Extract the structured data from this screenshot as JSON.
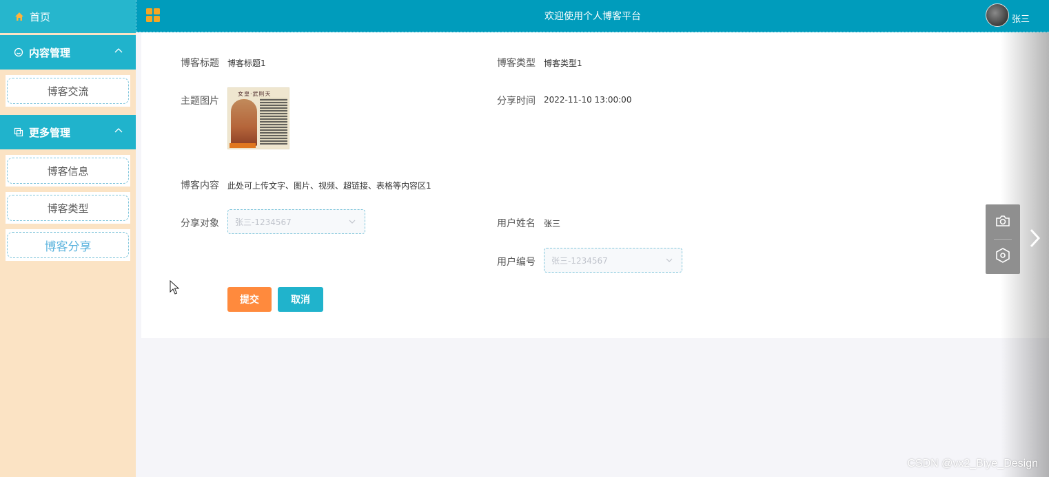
{
  "sidebar": {
    "home": "首页",
    "groups": [
      {
        "title": "内容管理",
        "items": [
          "博客交流"
        ]
      },
      {
        "title": "更多管理",
        "items": [
          "博客信息",
          "博客类型",
          "博客分享"
        ]
      }
    ]
  },
  "topbar": {
    "title": "欢迎使用个人博客平台",
    "user": "张三"
  },
  "form": {
    "blog_title_label": "博客标题",
    "blog_title_value": "博客标题1",
    "blog_type_label": "博客类型",
    "blog_type_value": "博客类型1",
    "cover_label": "主题图片",
    "cover_title": "女皇·武則天",
    "share_time_label": "分享时间",
    "share_time_value": "2022-11-10 13:00:00",
    "content_label": "博客内容",
    "content_value": "此处可上传文字、图片、视频、超链接、表格等内容区1",
    "share_target_label": "分享对象",
    "share_target_value": "张三-1234567",
    "user_name_label": "用户姓名",
    "user_name_value": "张三",
    "user_id_label": "用户编号",
    "user_id_value": "张三-1234567",
    "submit": "提交",
    "cancel": "取消"
  },
  "watermark": "CSDN @vx2_Biye_Design",
  "colors": {
    "sidebar_bg": "#fbe3c4",
    "accent": "#20b3cc",
    "topbar": "#009cbc",
    "submit": "#ff8a3d"
  }
}
